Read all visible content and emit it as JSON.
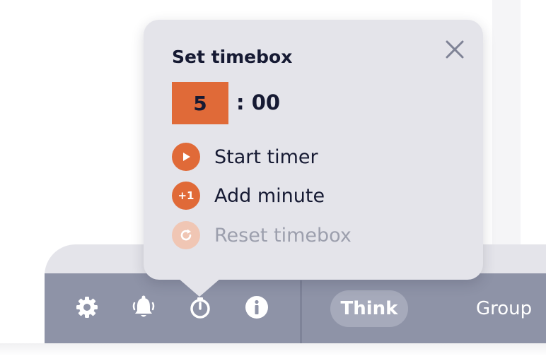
{
  "popover": {
    "title": "Set timebox",
    "minutes": "5",
    "seconds": ": 00",
    "close_icon": "close-icon",
    "actions": [
      {
        "label": "Start timer",
        "icon": "play-icon",
        "enabled": true
      },
      {
        "label": "Add minute",
        "icon": "plus-one-icon",
        "icon_text": "+1",
        "enabled": true
      },
      {
        "label": "Reset timebox",
        "icon": "reset-icon",
        "enabled": false
      }
    ]
  },
  "toolbar": {
    "icons": [
      "gear-icon",
      "bell-icon",
      "timer-icon",
      "info-icon"
    ],
    "tabs": [
      {
        "label": "Think",
        "active": true
      },
      {
        "label": "Group",
        "active": false
      }
    ]
  },
  "colors": {
    "accent": "#e06a38",
    "popover_bg": "#e4e4ea",
    "toolbar_bg": "#8e93a7",
    "text_dark": "#161a33"
  }
}
